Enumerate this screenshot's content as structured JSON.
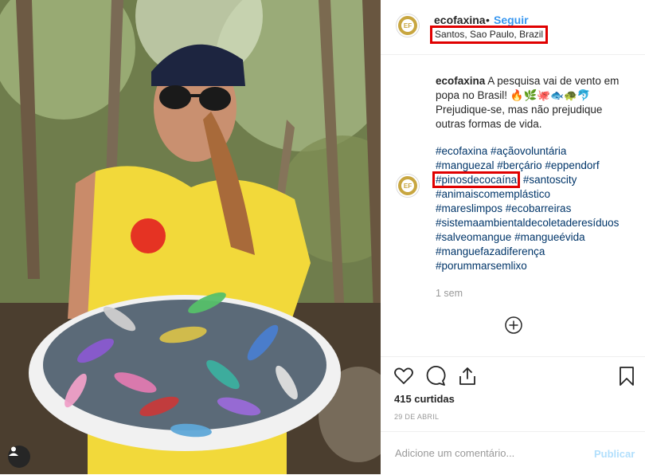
{
  "post": {
    "username": "ecofaxina",
    "dot": "•",
    "follow_label": "Seguir",
    "location": "Santos, Sao Paulo, Brazil",
    "avatar_text": "EF"
  },
  "caption": {
    "username": "ecofaxina",
    "text": " A pesquisa vai de vento em popa no Brasil! 🔥🌿🐙🐟🐢🐬 Prejudique-se, mas não prejudique outras formas de vida.",
    "hashtags": [
      "#ecofaxina #açãovoluntária",
      "#manguezal #berçário #eppendorf",
      "#pinosdecocaína",
      " #santoscity",
      "#animaiscomemplástico",
      "#mareslimpos #ecobarreiras",
      "#sistemaambientaldecoletaderesíduos",
      "#salveomangue #mangueévida",
      "#manguefazadiferença",
      "#porummarsemlixo"
    ],
    "time_ago": "1 sem"
  },
  "engagement": {
    "likes": "415 curtidas",
    "date": "29 DE ABRIL"
  },
  "composer": {
    "placeholder": "Adicione um comentário...",
    "publish_label": "Publicar"
  },
  "colors": {
    "link": "#3897f0",
    "hashtag": "#003569",
    "highlight_box": "#e00000",
    "publish_disabled": "#b2dffc"
  },
  "icons": [
    "heart-icon",
    "comment-icon",
    "share-icon",
    "bookmark-icon",
    "plus-circle-icon",
    "user-tag-icon"
  ]
}
